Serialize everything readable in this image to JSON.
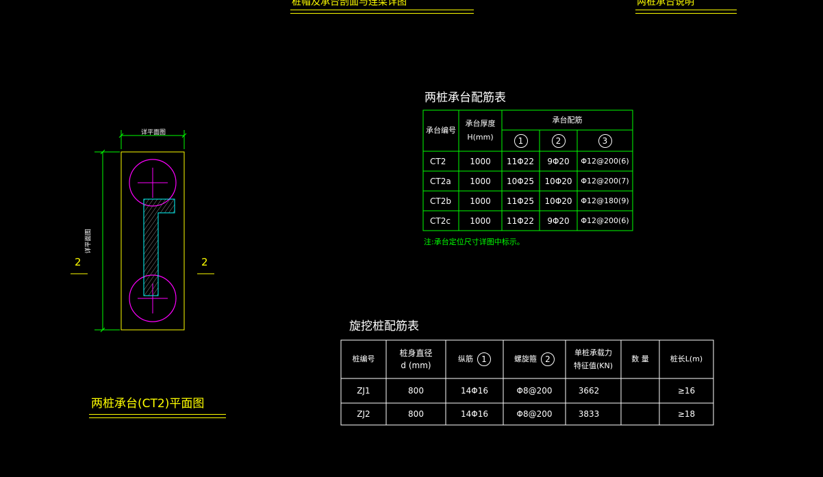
{
  "top_titles": {
    "left": "桩帽及承台剖面与连梁详图",
    "right": "两桩承台说明"
  },
  "plan": {
    "dim_top": "详平面图",
    "dim_left": "详平面图",
    "section_left": "2",
    "section_right": "2",
    "title": "两桩承台(CT2)平面图"
  },
  "ct_table": {
    "title": "两桩承台配筋表",
    "headers": {
      "id": "承台编号",
      "thick": "承台厚度",
      "thick_unit": "H(mm)",
      "rebar": "承台配筋"
    },
    "marks": [
      "1",
      "2",
      "3"
    ],
    "rows": [
      [
        "CT2",
        "1000",
        "11Φ22",
        "9Φ20",
        "Φ12@200(6)"
      ],
      [
        "CT2a",
        "1000",
        "10Φ25",
        "10Φ20",
        "Φ12@200(7)"
      ],
      [
        "CT2b",
        "1000",
        "11Φ25",
        "10Φ20",
        "Φ12@180(9)"
      ],
      [
        "CT2c",
        "1000",
        "11Φ22",
        "9Φ20",
        "Φ12@200(6)"
      ]
    ],
    "note": "注:承台定位尺寸详图中标示。"
  },
  "pile_table": {
    "title": "旋挖桩配筋表",
    "headers": {
      "id": "桩编号",
      "dia": "桩身直径",
      "dia_unit": "d (mm)",
      "long": "纵筋",
      "long_mark": "1",
      "spiral": "螺旋箍",
      "spiral_mark": "2",
      "cap1": "单桩承载力",
      "cap2": "特征值(KN)",
      "qty": "数 量",
      "len": "桩长L(m)"
    },
    "rows": [
      [
        "ZJ1",
        "800",
        "14Φ16",
        "Φ8@200",
        "3662",
        "",
        "≥16"
      ],
      [
        "ZJ2",
        "800",
        "14Φ16",
        "Φ8@200",
        "3833",
        "",
        "≥18"
      ]
    ]
  },
  "colors": {
    "yellow": "#ffff00",
    "green": "#00ff00",
    "magenta": "#ff00ff",
    "cyan": "#00ffff",
    "white": "#ffffff"
  }
}
